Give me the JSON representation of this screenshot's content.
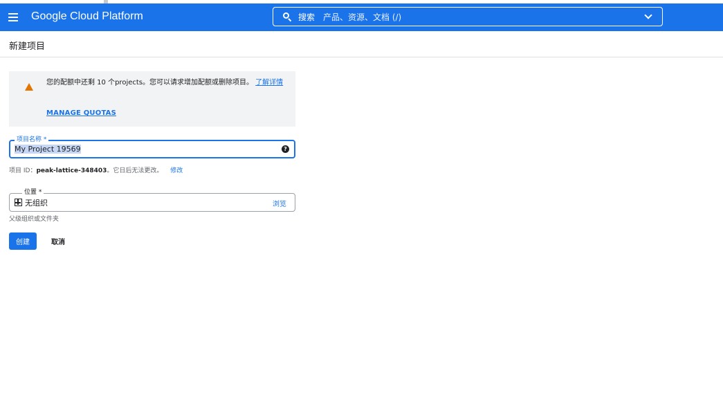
{
  "app": {
    "title": "Google Cloud Platform"
  },
  "search": {
    "label": "搜索",
    "hint": "产品、资源、文档 (/)"
  },
  "page": {
    "title": "新建项目"
  },
  "alert": {
    "text": "您的配额中还剩 10 个projects。您可以请求增加配额或删除项目。",
    "learn_more": "了解详情",
    "manage_quotas": "MANAGE QUOTAS"
  },
  "project_name": {
    "label": "项目名称 *",
    "value": "My Project 19569",
    "help_icon": "?"
  },
  "project_id": {
    "prefix": "项目 ID：",
    "value": "peak-lattice-348403",
    "suffix": "。它日后无法更改。",
    "edit_label": "修改"
  },
  "location": {
    "label": "位置 *",
    "value": "无组织",
    "browse_label": "浏览",
    "helper": "父级组织或文件夹"
  },
  "actions": {
    "create_label": "创建",
    "cancel_label": "取消"
  },
  "colors": {
    "brand": "#1a73e8",
    "warning": "#e37400",
    "alert_bg": "#f1f3f4"
  }
}
